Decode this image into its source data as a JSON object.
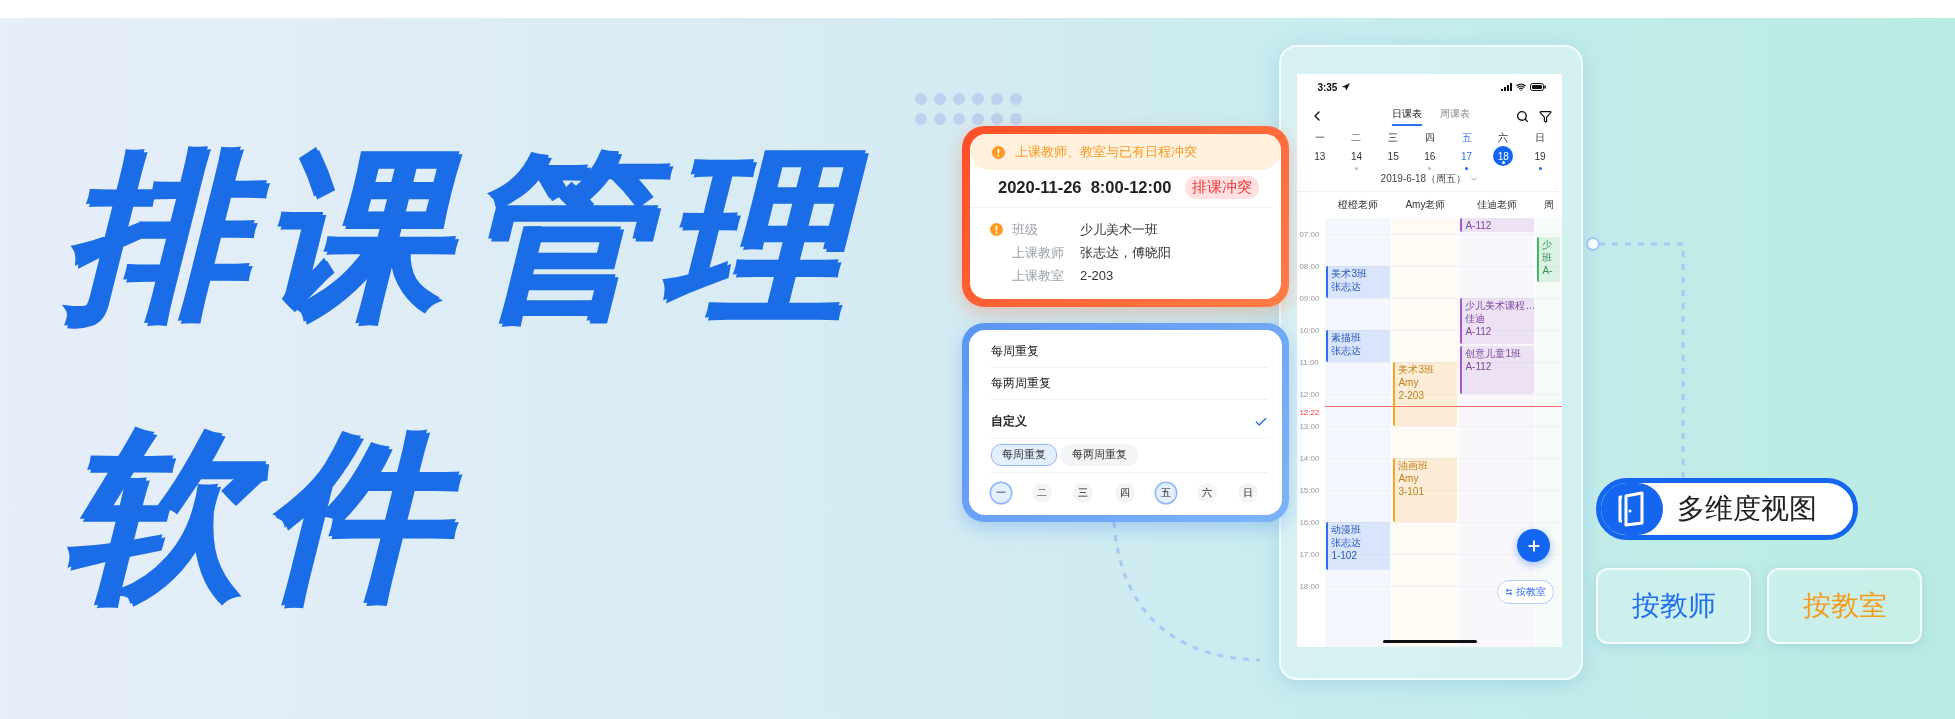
{
  "title": {
    "lines": [
      "排课管理",
      "软件"
    ]
  },
  "conflict_card": {
    "warning": "上课教师、教室与已有日程冲突",
    "datetime": "2020-11-26  8:00-12:00",
    "tag": "排课冲突",
    "rows": [
      {
        "label": "班级",
        "value": "少儿美术一班",
        "flagged": true
      },
      {
        "label": "上课教师",
        "value": "张志达，傅晓阳",
        "flagged": false
      },
      {
        "label": "上课教室",
        "value": "2-203",
        "flagged": false
      }
    ]
  },
  "repeat_card": {
    "options": [
      {
        "label": "每周重复",
        "selected": false
      },
      {
        "label": "每两周重复",
        "selected": false
      },
      {
        "label": "自定义",
        "selected": true
      }
    ],
    "chips": [
      {
        "label": "每周重复",
        "selected": true
      },
      {
        "label": "每两周重复",
        "selected": false
      }
    ],
    "days": [
      {
        "label": "一",
        "selected": true
      },
      {
        "label": "二",
        "selected": false
      },
      {
        "label": "三",
        "selected": false
      },
      {
        "label": "四",
        "selected": false
      },
      {
        "label": "五",
        "selected": true
      },
      {
        "label": "六",
        "selected": false
      },
      {
        "label": "日",
        "selected": false
      }
    ]
  },
  "phone": {
    "status_bar": {
      "time": "3:35"
    },
    "tabs": [
      {
        "label": "日课表",
        "selected": true
      },
      {
        "label": "周课表",
        "selected": false
      }
    ],
    "week": [
      {
        "weekday": "一",
        "date": "13",
        "selected": false,
        "today": false,
        "has_events": false
      },
      {
        "weekday": "二",
        "date": "14",
        "selected": false,
        "today": false,
        "has_events": true
      },
      {
        "weekday": "三",
        "date": "15",
        "selected": false,
        "today": false,
        "has_events": false
      },
      {
        "weekday": "四",
        "date": "16",
        "selected": false,
        "today": false,
        "has_events": true
      },
      {
        "weekday": "五",
        "date": "17",
        "selected": false,
        "today": true,
        "has_events": true
      },
      {
        "weekday": "六",
        "date": "18",
        "selected": true,
        "today": false,
        "has_events": true
      },
      {
        "weekday": "日",
        "date": "19",
        "selected": false,
        "today": false,
        "has_events": true
      }
    ],
    "date_label": "2019-6-18（周五）",
    "times": [
      "07:00",
      "08:00",
      "09:00",
      "10:00",
      "11:00",
      "12:00",
      "13:00",
      "14:00",
      "15:00",
      "16:00",
      "17:00",
      "18:00"
    ],
    "now_label": "12:22",
    "teachers": [
      {
        "name": "橙橙老师",
        "color": "#2f6fed",
        "events": [
          {
            "lines": [
              "美术3班",
              "张志达"
            ]
          },
          {
            "lines": [
              "素描班",
              "张志达"
            ]
          },
          {
            "lines": [
              "动漫班",
              "张志达",
              "1-102"
            ]
          }
        ]
      },
      {
        "name": "Amy老师",
        "color": "#f5a623",
        "events": [
          {
            "lines": [
              "美术3班",
              "Amy",
              "2-203"
            ]
          },
          {
            "lines": [
              "油画班",
              "Amy",
              "3-101"
            ]
          }
        ]
      },
      {
        "name": "佳迪老师",
        "color": "#a159c9",
        "events": [
          {
            "lines": [
              "A-112"
            ]
          },
          {
            "lines": [
              "少儿美术课程…",
              "佳迪",
              "A-112"
            ]
          },
          {
            "lines": [
              "创意儿童1班",
              "A-112"
            ]
          }
        ]
      },
      {
        "name": "周",
        "color": "#43b86b",
        "events": [
          {
            "lines": [
              "少",
              "班",
              "A-"
            ]
          }
        ]
      }
    ],
    "switch_button": "按教室"
  },
  "view_badge": {
    "label": "多维度视图"
  },
  "view_buttons": [
    {
      "label": "按教师",
      "color": "#1f6ff0"
    },
    {
      "label": "按教室",
      "color": "#f59b1b"
    }
  ]
}
